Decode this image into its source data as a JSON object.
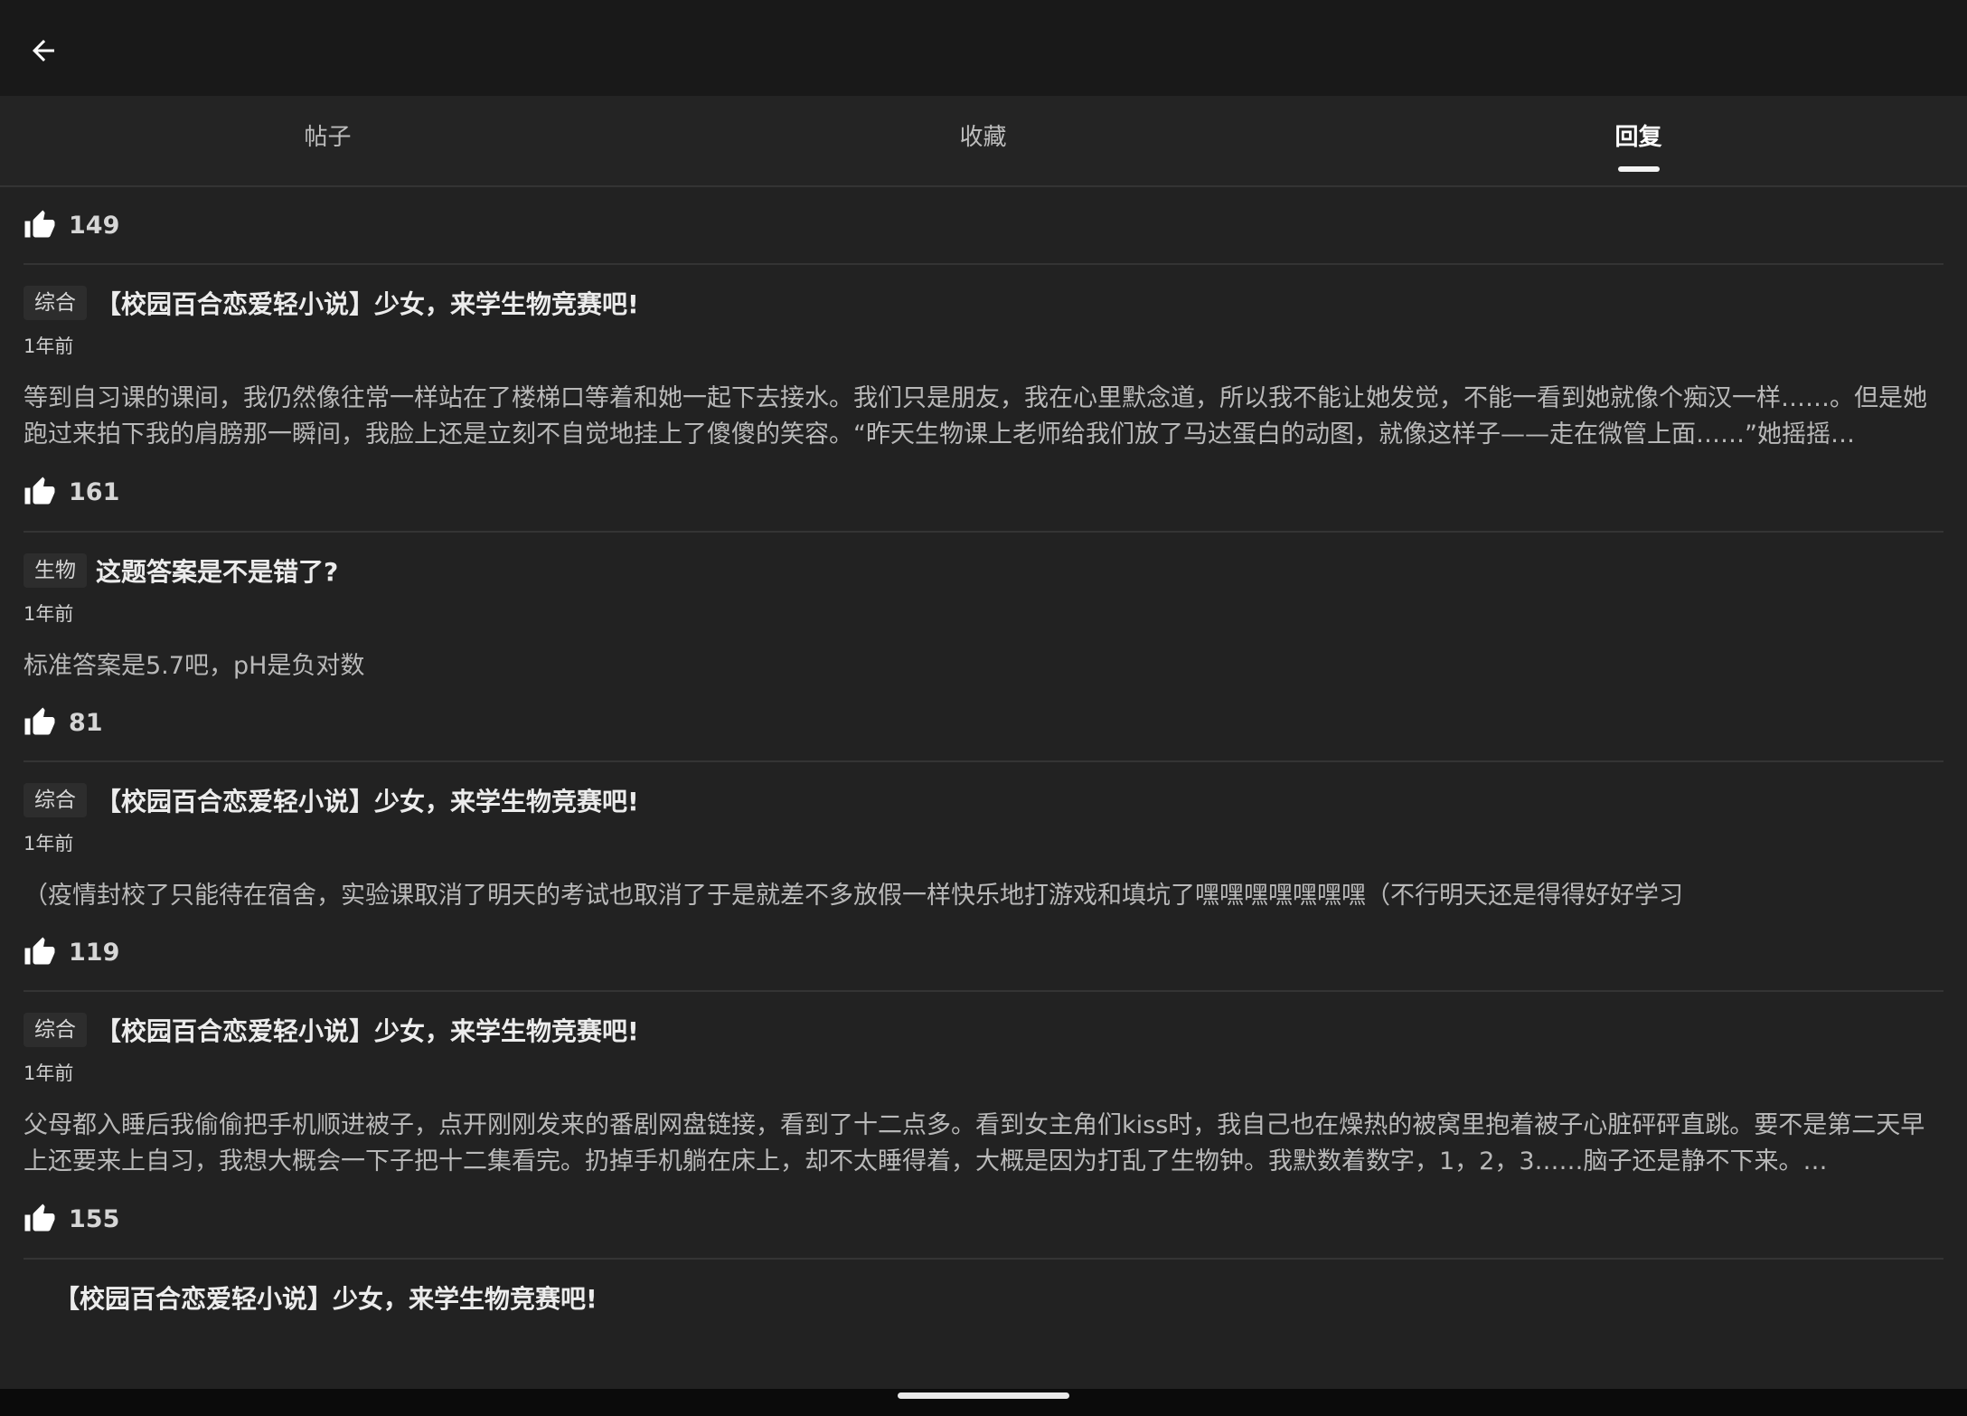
{
  "tabs": [
    {
      "label": "帖子",
      "active": false
    },
    {
      "label": "收藏",
      "active": false
    },
    {
      "label": "回复",
      "active": true
    }
  ],
  "first_like_count": "149",
  "posts": [
    {
      "tag": "综合",
      "title": "【校园百合恋爱轻小说】少女，来学生物竞赛吧!",
      "time": "1年前",
      "content": "等到自习课的课间，我仍然像往常一样站在了楼梯口等着和她一起下去接水。我们只是朋友，我在心里默念道，所以我不能让她发觉，不能一看到她就像个痴汉一样……。但是她跑过来拍下我的肩膀那一瞬间，我脸上还是立刻不自觉地挂上了傻傻的笑容。“昨天生物课上老师给我们放了马达蛋白的动图，就像这样子——走在微管上面……”她摇摇…",
      "likes": "161"
    },
    {
      "tag": "生物",
      "title": "这题答案是不是错了?",
      "time": "1年前",
      "content": "标准答案是5.7吧，pH是负对数",
      "likes": "81"
    },
    {
      "tag": "综合",
      "title": "【校园百合恋爱轻小说】少女，来学生物竞赛吧!",
      "time": "1年前",
      "content": "（疫情封校了只能待在宿舍，实验课取消了明天的考试也取消了于是就差不多放假一样快乐地打游戏和填坑了嘿嘿嘿嘿嘿嘿嘿（不行明天还是得得好好学习",
      "likes": "119"
    },
    {
      "tag": "综合",
      "title": "【校园百合恋爱轻小说】少女，来学生物竞赛吧!",
      "time": "1年前",
      "content": "父母都入睡后我偷偷把手机顺进被子，点开刚刚发来的番剧网盘链接，看到了十二点多。看到女主角们kiss时，我自己也在燥热的被窝里抱着被子心脏砰砰直跳。要不是第二天早上还要来上自习，我想大概会一下子把十二集看完。扔掉手机躺在床上，却不太睡得着，大概是因为打乱了生物钟。我默数着数字，1，2，3……脑子还是静不下来。…",
      "likes": "155"
    },
    {
      "tag": "",
      "title": "【校园百合恋爱轻小说】少女，来学生物竞赛吧!",
      "time": "",
      "content": "",
      "likes": ""
    }
  ]
}
